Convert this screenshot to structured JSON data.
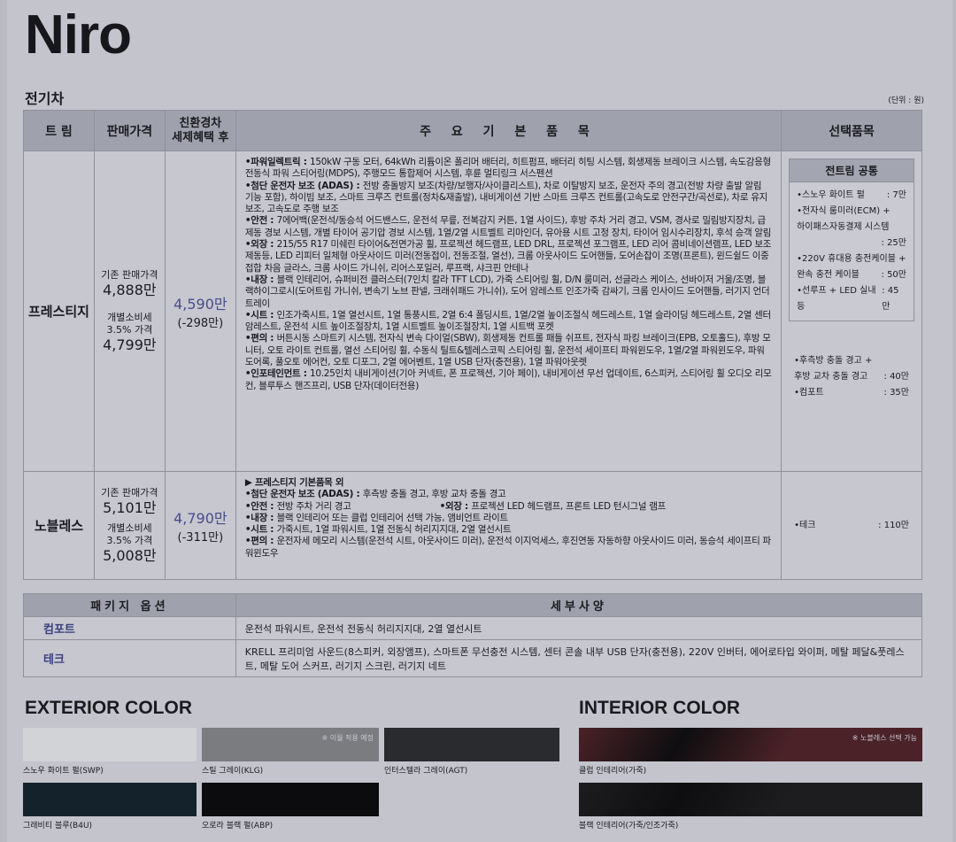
{
  "page": {
    "title": "Niro",
    "subtitle": "전기차",
    "unit": "(단위 : 원)"
  },
  "table_headers": {
    "trim": "트 림",
    "price": "판매가격",
    "benefit": "친환경차\n세제혜택 후",
    "features": "주 요 기 본 품 목",
    "options": "선택품목"
  },
  "prestige": {
    "name": "프레스티지",
    "base_label": "기존 판매가격",
    "base_price": "4,888만",
    "tax_label1": "개별소비세",
    "tax_label2": "3.5% 가격",
    "tax_price": "4,799만",
    "benefit_price": "4,590만",
    "benefit_diff": "(-298만)",
    "features": [
      {
        "head": "•파워일렉트릭 : ",
        "text": "150kW 구동 모터, 64kWh 리튬이온 폴리머 배터리, 히트펌프, 배터리 히팅 시스템, 회생제동 브레이크 시스템, 속도감응형 전동식 파워 스티어링(MDPS), 주행모드 통합제어 시스템, 후륜 멀티링크 서스펜션"
      },
      {
        "head": "•첨단 운전자 보조 (ADAS) : ",
        "text": "전방 충돌방지 보조(차량/보행자/사이클리스트), 차로 이탈방지 보조, 운전자 주의 경고(전방 차량 출발 알림 기능 포함), 하이빔 보조, 스마트 크루즈 컨트롤(정차&재출발), 내비게이션 기반 스마트 크루즈 컨트롤(고속도로 안전구간/곡선로), 차로 유지 보조, 고속도로 주행 보조"
      },
      {
        "head": "•안전 : ",
        "text": "7에어백(운전석/동승석 어드밴스드, 운전석 무릎, 전복감지 커튼, 1열 사이드), 후방 주차 거리 경고, VSM, 경사로 밀림방지장치, 급제동 경보 시스템, 개별 타이어 공기압 경보 시스템, 1열/2열 시트벨트 리마인더, 유아용 시트 고정 장치, 타이어 임시수리장치, 후석 승객 알림"
      },
      {
        "head": "•외장 : ",
        "text": "215/55 R17 미쉐린 타이어&전면가공 휠, 프로젝션 헤드램프, LED DRL, 프로젝션 포그램프, LED 리어 콤비네이션램프, LED 보조제동등, LED 리피터 일체형 아웃사이드 미러(전동접이, 전동조절, 열선), 크롬 아웃사이드 도어핸들, 도어손잡이 조명(프론트), 윈드쉴드 이중접합 차음 글라스, 크롬 사이드 가니쉬, 리어스포일러, 루프랙, 샤크핀 안테나"
      },
      {
        "head": "•내장 : ",
        "text": "블랙 인테리어, 슈퍼비전 클러스터(7인치 칼라 TFT LCD), 가죽 스티어링 휠, D/N 룸미러, 선글라스 케이스, 선바이저 거울/조명, 블랙하이그로시(도어트림 가니쉬, 변속기 노브 판넬, 크래쉬패드 가니쉬), 도어 암레스트 인조가죽 감싸기, 크롬 인사이드 도어핸들, 러기지 언더트레이"
      },
      {
        "head": "•시트 : ",
        "text": "인조가죽시트, 1열 열선시트, 1열 통풍시트, 2열 6:4 폴딩시트, 1열/2열 높이조절식 헤드레스트, 1열 슬라이딩 헤드레스트, 2열 센터 암레스트, 운전석 시트 높이조절장치, 1열 시트벨트 높이조절장치, 1열 시트백 포켓"
      },
      {
        "head": "•편의 : ",
        "text": "버튼시동 스마트키 시스템, 전자식 변속 다이얼(SBW), 회생제동 컨트롤 패들 쉬프트, 전자식 파킹 브레이크(EPB, 오토홀드), 후방 모니터, 오토 라이트 컨트롤, 열선 스티어링 휠, 수동식 틸트&텔레스코픽 스티어링 휠, 운전석 세이프티 파워윈도우, 1열/2열 파워윈도우, 파워 도어록, 풀오토 에어컨, 오토 디포그, 2열 에어벤트, 1열 USB 단자(충전용), 1열 파워아웃렛"
      },
      {
        "head": "•인포테인먼트 : ",
        "text": "10.25인치 내비게이션(기아 커넥트, 폰 프로젝션, 기아 페이), 내비게이션 무선 업데이트, 6스피커, 스티어링 휠 오디오 리모컨, 블루투스 핸즈프리, USB 단자(데이터전용)"
      }
    ],
    "opt_box_head": "전트림 공통",
    "opt_box": [
      {
        "name": "•스노우 화이트 펄",
        "price": ": 7만"
      },
      {
        "name": "•전자식 룸미러(ECM) +",
        "price": ""
      },
      {
        "name": "하이패스자동결제 시스템",
        "price": ""
      },
      {
        "name": "",
        "price": ": 25만"
      },
      {
        "name": "•220V 휴대용 충전케이블 +",
        "price": ""
      },
      {
        "name": "완속 충전 케이블",
        "price": ": 50만"
      },
      {
        "name": "•선루프 + LED 실내등",
        "price": ": 45만"
      }
    ],
    "opt_free": [
      {
        "name": "•후측방 충돌 경고 +",
        "price": ""
      },
      {
        "name": "후방 교차 충돌 경고",
        "price": ": 40만"
      },
      {
        "name": "•컴포트",
        "price": ": 35만"
      }
    ]
  },
  "noblesse": {
    "name": "노블레스",
    "base_label": "기존 판매가격",
    "base_price": "5,101만",
    "tax_label1": "개별소비세",
    "tax_label2": "3.5% 가격",
    "tax_price": "5,008만",
    "benefit_price": "4,790만",
    "benefit_diff": "(-311만)",
    "intro": "▶ 프레스티지 기본품목 외",
    "features": [
      {
        "head": "•첨단 운전자 보조 (ADAS) : ",
        "text": "후측방 충돌 경고, 후방 교차 충돌 경고"
      },
      {
        "head": "•안전 : ",
        "text": "전방 주차 거리 경고",
        "head2": "•외장 : ",
        "text2": "프로젝션 LED 헤드램프, 프론트 LED 턴시그널 램프"
      },
      {
        "head": "•내장 : ",
        "text": "블랙 인테리어 또는 클럽 인테리어 선택 가능, 앰비언트 라이트"
      },
      {
        "head": "•시트 : ",
        "text": "가죽시트, 1열 파워시트, 1열 전동식 허리지지대, 2열 열선시트"
      },
      {
        "head": "•편의 : ",
        "text": "운전자세 메모리 시스템(운전석 시트, 아웃사이드 미러), 운전석 이지억세스, 후진연동 자동하향 아웃사이드 미러, 동승석 세이프티 파워윈도우"
      }
    ],
    "option": {
      "name": "•테크",
      "price": ": 110만"
    }
  },
  "package": {
    "head_option": "패키지 옵션",
    "head_detail": "세부사양",
    "rows": [
      {
        "name": "컴포트",
        "detail": "운전석 파워시트, 운전석 전동식 허리지지대, 2열 열선시트"
      },
      {
        "name": "테크",
        "detail": "KRELL 프리미엄 사운드(8스피커, 외장앰프), 스마트폰 무선충전 시스템, 센터 콘솔 내부 USB 단자(충전용), 220V 인버터, 에어로타입 와이퍼, 메탈 페달&풋레스트, 메탈 도어 스커프, 러기지 스크린, 러기지 네트"
      }
    ]
  },
  "exterior": {
    "title": "EXTERIOR COLOR",
    "colors": [
      {
        "label": "스노우 화이트 펄(SWP)",
        "color": "#d2d3d6",
        "note": ""
      },
      {
        "label": "스틸 그레이(KLG)",
        "color": "#7b7c80",
        "note": "※ 이월 적용 예정"
      },
      {
        "label": "인터스텔라 그레이(AGT)",
        "color": "#2a2b2e",
        "note": ""
      },
      {
        "label": "그래비티 블루(B4U)",
        "color": "#14222c",
        "note": ""
      },
      {
        "label": "오로라 블랙 펄(ABP)",
        "color": "#0c0c0e",
        "note": ""
      }
    ]
  },
  "interior": {
    "title": "INTERIOR COLOR",
    "colors": [
      {
        "label": "클럽 인테리어(가죽)",
        "color": "#4a2228",
        "note": "※ 노블레스 선택 가능"
      },
      {
        "label": "블랙 인테리어(가죽/인조가죽)",
        "color": "#1d1d20",
        "note": ""
      }
    ]
  }
}
